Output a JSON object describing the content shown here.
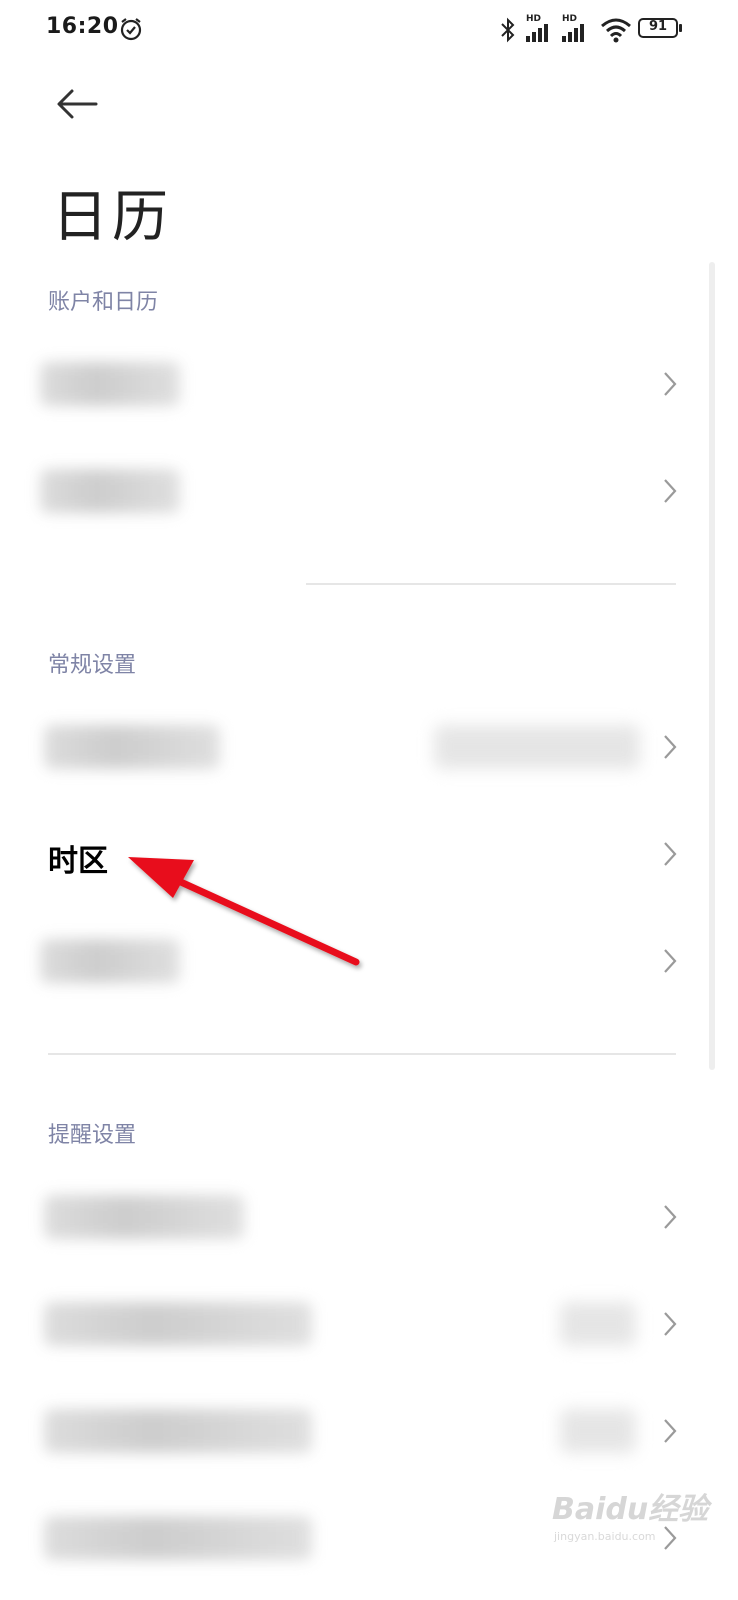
{
  "status_bar": {
    "time": "16:20",
    "battery": "91",
    "signal_badge_1": "HD",
    "signal_badge_2": "HD"
  },
  "page": {
    "title": "日历"
  },
  "sections": {
    "accounts": {
      "header": "账户和日历"
    },
    "general": {
      "header": "常规设置",
      "timezone_label": "时区"
    },
    "reminders": {
      "header": "提醒设置"
    }
  },
  "watermark": {
    "text": "Baidu经验",
    "sub": "jingyan.baidu.com"
  },
  "colors": {
    "section_header": "#7f84a6",
    "annotation_arrow": "#e8101a",
    "background": "#ffffff"
  },
  "icons": {
    "back": "arrow-left-icon",
    "chevron": "chevron-right-icon",
    "alarm": "alarm-clock-icon"
  }
}
